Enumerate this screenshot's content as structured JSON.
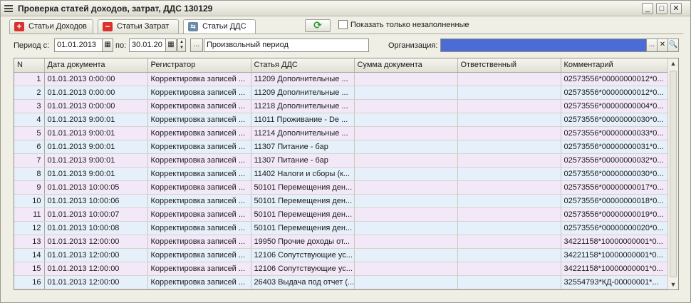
{
  "window": {
    "title": "Проверка статей доходов, затрат, ДДС 130129",
    "controls": {
      "minimize": "_",
      "maximize": "□",
      "close": "✕"
    }
  },
  "tabs": [
    {
      "label": "Статьи Доходов",
      "icon": "plus-icon",
      "active": false
    },
    {
      "label": "Статьи Затрат",
      "icon": "minus-icon",
      "active": false
    },
    {
      "label": "Статьи ДДС",
      "icon": "dds-icon",
      "active": true
    }
  ],
  "toolbar": {
    "refresh_icon": "refresh-icon",
    "show_unfilled_label": "Показать только незаполненные",
    "show_unfilled_checked": false
  },
  "filters": {
    "period_from_label": "Период с:",
    "period_from": "01.01.2013",
    "period_to_label": "по:",
    "period_to": "30.01.20",
    "period_button": "...",
    "period_type": "Произвольный период",
    "org_label": "Организация:",
    "org_value": "",
    "org_select": "...",
    "org_clear": "✕",
    "org_search": "🔍"
  },
  "table": {
    "columns": [
      "N",
      "Дата документа",
      "Регистратор",
      "Статья ДДС",
      "Сумма документа",
      "Ответственный",
      "Комментарий"
    ],
    "rows": [
      [
        "1",
        "01.01.2013 0:00:00",
        "Корректировка записей ...",
        "11209 Дополнительные ...",
        "",
        "",
        "02573556*00000000012*0..."
      ],
      [
        "2",
        "01.01.2013 0:00:00",
        "Корректировка записей ...",
        "11209 Дополнительные ...",
        "",
        "",
        "02573556*00000000012*0..."
      ],
      [
        "3",
        "01.01.2013 0:00:00",
        "Корректировка записей ...",
        "11218 Дополнительные ...",
        "",
        "",
        "02573556*00000000004*0..."
      ],
      [
        "4",
        "01.01.2013 9:00:01",
        "Корректировка записей ...",
        "11011 Проживание - De ...",
        "",
        "",
        "02573556*00000000030*0..."
      ],
      [
        "5",
        "01.01.2013 9:00:01",
        "Корректировка записей ...",
        "11214 Дополнительные ...",
        "",
        "",
        "02573556*00000000033*0..."
      ],
      [
        "6",
        "01.01.2013 9:00:01",
        "Корректировка записей ...",
        "11307 Питание - бар",
        "",
        "",
        "02573556*00000000031*0..."
      ],
      [
        "7",
        "01.01.2013 9:00:01",
        "Корректировка записей ...",
        "11307 Питание - бар",
        "",
        "",
        "02573556*00000000032*0..."
      ],
      [
        "8",
        "01.01.2013 9:00:01",
        "Корректировка записей ...",
        "11402 Налоги и сборы (к...",
        "",
        "",
        "02573556*00000000030*0..."
      ],
      [
        "9",
        "01.01.2013 10:00:05",
        "Корректировка записей ...",
        "50101 Перемещения ден...",
        "",
        "",
        "02573556*00000000017*0..."
      ],
      [
        "10",
        "01.01.2013 10:00:06",
        "Корректировка записей ...",
        "50101 Перемещения ден...",
        "",
        "",
        "02573556*00000000018*0..."
      ],
      [
        "11",
        "01.01.2013 10:00:07",
        "Корректировка записей ...",
        "50101 Перемещения ден...",
        "",
        "",
        "02573556*00000000019*0..."
      ],
      [
        "12",
        "01.01.2013 10:00:08",
        "Корректировка записей ...",
        "50101 Перемещения ден...",
        "",
        "",
        "02573556*00000000020*0..."
      ],
      [
        "13",
        "01.01.2013 12:00:00",
        "Корректировка записей ...",
        "19950 Прочие доходы от...",
        "",
        "",
        "34221158*10000000001*0..."
      ],
      [
        "14",
        "01.01.2013 12:00:00",
        "Корректировка записей ...",
        "12106 Сопутствующие ус...",
        "",
        "",
        "34221158*10000000001*0..."
      ],
      [
        "15",
        "01.01.2013 12:00:00",
        "Корректировка записей ...",
        "12106 Сопутствующие ус...",
        "",
        "",
        "34221158*10000000001*0..."
      ],
      [
        "16",
        "01.01.2013 12:00:00",
        "Корректировка записей ...",
        "26403 Выдача под отчет (...",
        "",
        "",
        "32554793*КД-00000001*..."
      ]
    ]
  },
  "scrollbar": {
    "up": "▲",
    "down": "▼"
  }
}
